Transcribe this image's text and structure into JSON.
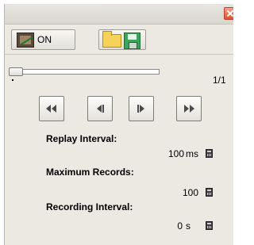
{
  "toolbar": {
    "record_toggle_label": "ON",
    "record_toggle_icon": "film-record-icon",
    "open_icon": "folder-icon",
    "save_icon": "save-icon"
  },
  "playback": {
    "frame_counter": "1/1",
    "slider_position": 0,
    "buttons": [
      "first-frame",
      "previous-frame",
      "next-frame",
      "last-frame"
    ]
  },
  "settings": {
    "replay_interval": {
      "label": "Replay Interval:",
      "value": "100",
      "unit": "ms"
    },
    "maximum_records": {
      "label": "Maximum Records:",
      "value": "100"
    },
    "recording_interval": {
      "label": "Recording Interval:",
      "value": "0",
      "unit": "s"
    }
  },
  "colors": {
    "panel_background": "#ece9e3",
    "close_button": "#e2502e",
    "save_icon": "#3ea35b",
    "folder_icon": "#f7d25a"
  }
}
